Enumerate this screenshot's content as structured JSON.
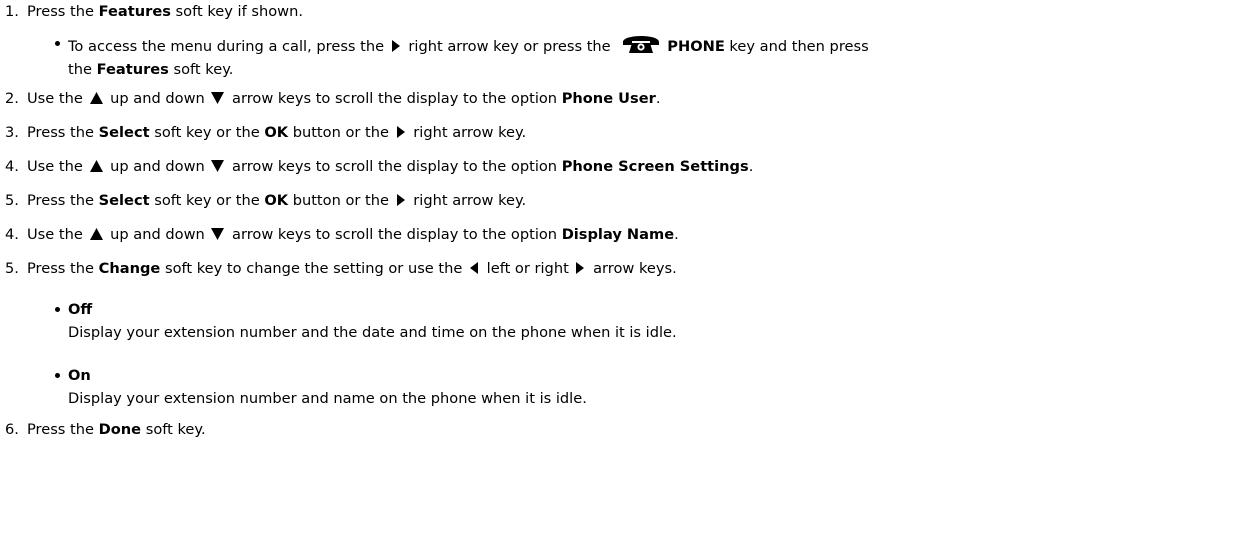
{
  "steps": [
    {
      "num": "1.",
      "pre": "Press the ",
      "bold": "Features",
      "post": " soft key if shown."
    },
    {
      "num": "2.",
      "a": "Use the ",
      "b": " up and down ",
      "c": " arrow keys to scroll the display to the option ",
      "bold": "Phone User",
      "d": "."
    },
    {
      "num": "3.",
      "a": "Press the ",
      "bold1": "Select",
      "b": " soft key or the ",
      "bold2": "OK",
      "c": " button or the ",
      "d": " right arrow key."
    },
    {
      "num": "4.",
      "a": "Use the ",
      "b": " up and down ",
      "c": " arrow keys to scroll the display to the option ",
      "bold": "Phone Screen Settings",
      "d": "."
    },
    {
      "num": "5.",
      "a": "Press the ",
      "bold1": "Select",
      "b": " soft key or the ",
      "bold2": "OK",
      "c": " button or the ",
      "d": " right arrow key."
    },
    {
      "num": "4.",
      "a": "Use the ",
      "b": " up and down ",
      "c": " arrow keys to scroll the display to the option ",
      "bold": "Display Name",
      "d": "."
    },
    {
      "num": "5.",
      "a": "Press the ",
      "bold": "Change",
      "b": " soft key to change the setting or use the ",
      "c": " left or right ",
      "d": " arrow keys."
    },
    {
      "num": "6.",
      "a": "Press the ",
      "bold": "Done",
      "b": " soft key."
    }
  ],
  "call_note": {
    "a": "To access the menu during a call, press the ",
    "b": " right arrow key or press the ",
    "bold1": "PHONE",
    "c": " key and then press",
    "d": "the ",
    "bold2": "Features",
    "e": " soft key."
  },
  "options": [
    {
      "title": "Off",
      "desc": "Display your extension number and the date and time on the phone when it is idle."
    },
    {
      "title": "On",
      "desc": "Display your extension number and name on the phone when it is idle."
    }
  ],
  "icons": {
    "right": "right-arrow-icon",
    "left": "left-arrow-icon",
    "up": "up-arrow-icon",
    "down": "down-arrow-icon",
    "phone": "phone-key-icon"
  }
}
